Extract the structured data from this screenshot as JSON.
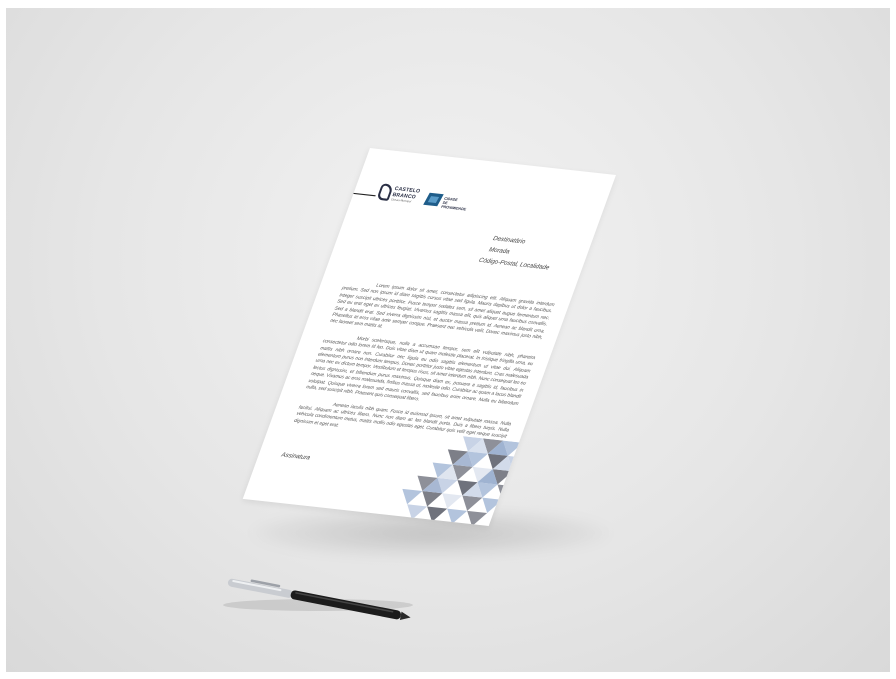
{
  "letterhead": {
    "logo_left": {
      "line1": "CASTELO",
      "line2": "BRANCO",
      "tagline": "Câmara Municipal",
      "icon": "castle-logo-icon"
    },
    "logo_right": {
      "line1": "CIDADE",
      "line2": "DE",
      "line3": "PROXIMIDADE",
      "icon": "cube-logo-icon"
    }
  },
  "recipient": {
    "name": "Destinatário",
    "address": "Morada",
    "postal": "Código-Postal, Localidade"
  },
  "body": {
    "p1": "Lorem ipsum dolor sit amet, consectetur adipiscing elit. Aliquam gravida interdum pretium. Sed non ipsum id diam sagittis cursus vitae sed ligula. Mauris dapibus ut dolor a faucibus. Integer suscipit ultrices porttitor. Fusce tempor sodales sem, sit amet aliquet augue fermentum nec. Sed eu erat eget ex ultrices feugiat. Vivamus sagittis massa elit, quis aliquet urna faucibus convallis. Sed a blandit erat. Sed viverra dignissim nisl, et auctor massa pretium id. Aenean ac blandit urna. Phasellus at eros vitae ante semper congue. Praesent nec vehicula velit. Donec maximus justo nibh, nec laoreet sem mattis at.",
    "p2": "Morbi scelerisque, nulla a accumsan tempor, sem elit vulputate nibh, pharetra consectetur odio lorem id leo. Duis vitae diam ut quam molestie placerat. In tristique fringilla urna, eu mattis nibh ornare non. Curabitur nec ligula eu odio sagittis elementum ut vitae dui. Aliquam elementum purus non interdum tempus. Donec porttitor justo vitae egestas interdum. Cras malesuada urna nec ex dictum tempor. Vestibulum et tempus risus, sit amet interdum nibh. Nunc consequat leo eu lectus dignissim, et bibendum purus maximus. Quisque diam ex, posuere a sagittis id, faucibus in neque. Vivamus ac eros malesuada, finibus massa ut, molestie odio. Curabitur ac quam a lacus blandit volutpat. Quisque viverra lorem sed mauris convallis, sed faucibus enim ornare. Nulla eu bibendum nulla, sed suscipit nibh. Praesent quis consequat libero.",
    "p3": "Aenean iaculis nibh quam. Fusce id euismod ipsum, sit amet vulputate massa. Nulla facilisi. Aliquam ac ultrices libero. Nunc non diam ac leo blandit porta. Duis a libero turpis. Nulla vehicula condimentum metus, mattis mollis odio egestas eget. Curabitur quis velit eget neque suscipit dignissim et eget erat."
  },
  "signature": {
    "label": "Assinatura"
  },
  "colors": {
    "background": "#e6e6e6",
    "paper": "#ffffff",
    "brand_dark": "#2a2f45",
    "brand_blue": "#1f5d8a",
    "pattern_light_blue": "#b3c4dd",
    "pattern_gray": "#8e9099",
    "pen_body": "#1c1c1c",
    "pen_cap": "#c9ccd1"
  }
}
